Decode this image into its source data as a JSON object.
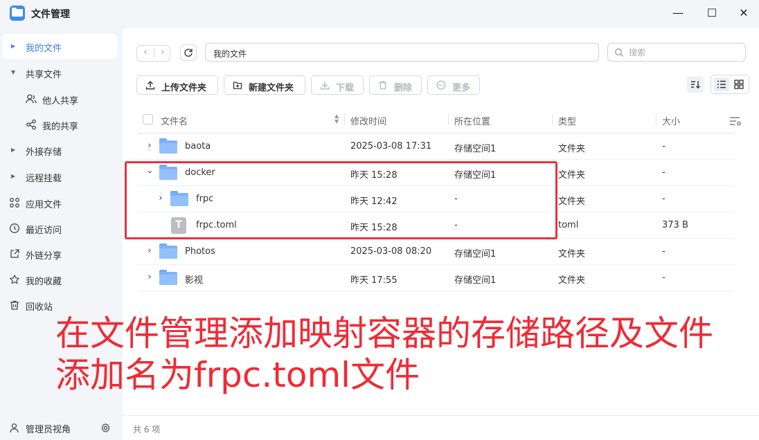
{
  "window": {
    "title": "文件管理",
    "controls": [
      "—",
      "☐",
      "✕"
    ]
  },
  "sidebar": {
    "items": [
      {
        "label": "我的文件",
        "type": "expandable",
        "active": true
      },
      {
        "label": "共享文件",
        "type": "expanded"
      },
      {
        "label": "他人共享",
        "type": "sub",
        "icon": "users-icon"
      },
      {
        "label": "我的共享",
        "type": "sub",
        "icon": "share-icon"
      },
      {
        "label": "外接存储",
        "type": "expandable"
      },
      {
        "label": "远程挂载",
        "type": "expandable"
      },
      {
        "label": "应用文件",
        "icon": "apps-icon"
      },
      {
        "label": "最近访问",
        "icon": "clock-icon"
      },
      {
        "label": "外链分享",
        "icon": "link-share-icon"
      },
      {
        "label": "我的收藏",
        "icon": "star-icon"
      },
      {
        "label": "回收站",
        "icon": "trash-icon"
      }
    ],
    "footer_label": "管理员视角"
  },
  "toolbar": {
    "path": "我的文件",
    "search_placeholder": "搜索",
    "buttons": [
      {
        "label": "上传文件夹",
        "enabled": true
      },
      {
        "label": "新建文件夹",
        "enabled": true
      },
      {
        "label": "下载",
        "enabled": false
      },
      {
        "label": "删除",
        "enabled": false
      },
      {
        "label": "更多",
        "enabled": false
      }
    ]
  },
  "table": {
    "columns": [
      "文件名",
      "修改时间",
      "所在位置",
      "类型",
      "大小"
    ],
    "rows": [
      {
        "name": "baota",
        "modified": "2025-03-08 17:31",
        "location": "存储空间1",
        "type": "文件夹",
        "size": "-",
        "kind": "folder",
        "expanded": false,
        "depth": 0
      },
      {
        "name": "docker",
        "modified": "昨天 15:28",
        "location": "存储空间1",
        "type": "文件夹",
        "size": "-",
        "kind": "folder",
        "expanded": true,
        "depth": 0
      },
      {
        "name": "frpc",
        "modified": "昨天 12:42",
        "location": "-",
        "type": "文件夹",
        "size": "-",
        "kind": "folder",
        "expanded": false,
        "depth": 1
      },
      {
        "name": "frpc.toml",
        "modified": "昨天 15:28",
        "location": "-",
        "type": "toml",
        "size": "373 B",
        "kind": "file",
        "depth": 1
      },
      {
        "name": "Photos",
        "modified": "2025-03-08 08:20",
        "location": "存储空间1",
        "type": "文件夹",
        "size": "-",
        "kind": "folder",
        "expanded": false,
        "depth": 0
      },
      {
        "name": "影视",
        "modified": "昨天 17:55",
        "location": "存储空间1",
        "type": "文件夹",
        "size": "-",
        "kind": "folder",
        "expanded": false,
        "depth": 0
      }
    ]
  },
  "status": {
    "count_text": "共 6 项"
  },
  "annotation": {
    "lines": [
      "在文件管理添加映射容器的存储路径及文件",
      "添加名为frpc.toml文件"
    ],
    "color": "#ee2b36"
  },
  "colors": {
    "accent": "#3d7df5",
    "folder": "#7eb2f9",
    "highlight": "#e8323e"
  }
}
